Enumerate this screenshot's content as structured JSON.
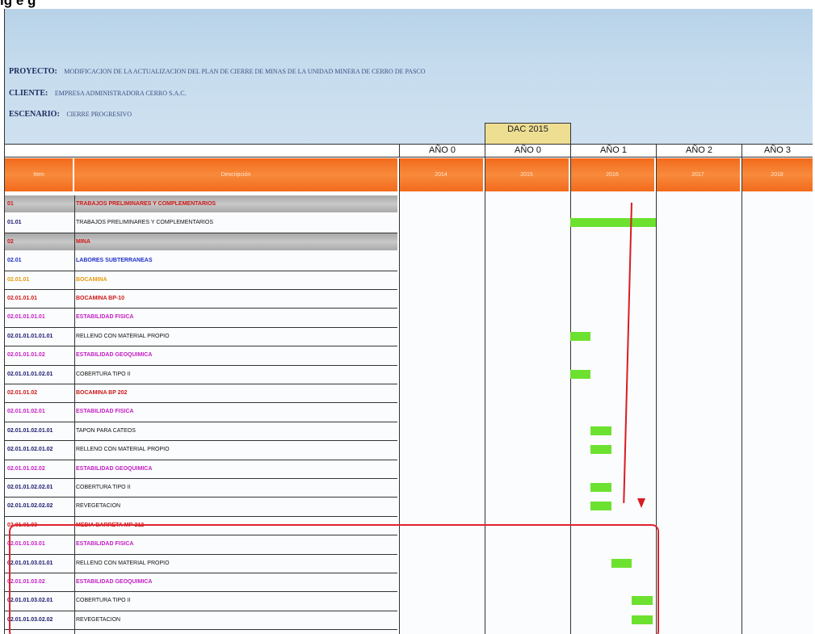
{
  "caption": "ig  e        g",
  "header": {
    "proyecto_label": "PROYECTO:",
    "proyecto_value": "MODIFICACION DE LA ACTUALIZACION DEL PLAN DE CIERRE DE MINAS DE LA UNIDAD MINERA DE CERRO DE PASCO",
    "cliente_label": "CLIENTE:",
    "cliente_value": "EMPRESA ADMINISTRADORA CERRO S.A.C.",
    "escenario_label": "ESCENARIO:",
    "escenario_value": "CIERRE PROGRESIVO",
    "dac_label": "DAC 2015"
  },
  "columns": {
    "item": "Item",
    "descripcion": "Descripción",
    "years": [
      {
        "label": "AÑO 0",
        "year": "2014"
      },
      {
        "label": "AÑO 0",
        "year": "2015"
      },
      {
        "label": "AÑO 1",
        "year": "2016"
      },
      {
        "label": "AÑO 2",
        "year": "2017"
      },
      {
        "label": "AÑO 3",
        "year": "2018"
      }
    ]
  },
  "rows": [
    {
      "code": "01",
      "desc": "TRABAJOS PRELIMINARES Y COMPLEMENTARIOS",
      "style": "grey",
      "color": "#d01818"
    },
    {
      "code": "01.01",
      "desc": "TRABAJOS PRELIMINARES Y COMPLEMENTARIOS",
      "style": "plain",
      "color": "#111111"
    },
    {
      "code": "02",
      "desc": "MINA",
      "style": "grey",
      "color": "#d01818"
    },
    {
      "code": "02.01",
      "desc": "LABORES SUBTERRANEAS",
      "style": "white",
      "color": "#1f2fc9"
    },
    {
      "code": "02.01.01",
      "desc": "BOCAMINA",
      "style": "white",
      "color": "#e69a0a"
    },
    {
      "code": "02.01.01.01",
      "desc": "BOCAMINA BP-10",
      "style": "white",
      "color": "#d01818"
    },
    {
      "code": "02.01.01.01.01",
      "desc": "ESTABILIDAD FISICA",
      "style": "white",
      "color": "#c41ec4"
    },
    {
      "code": "02.01.01.01.01.01",
      "desc": "RELLENO CON MATERIAL PROPIO",
      "style": "plain",
      "color": "#111111"
    },
    {
      "code": "02.01.01.01.02",
      "desc": "ESTABILIDAD GEOQUIMICA",
      "style": "white",
      "color": "#c41ec4"
    },
    {
      "code": "02.01.01.01.02.01",
      "desc": "COBERTURA TIPO II",
      "style": "plain",
      "color": "#111111"
    },
    {
      "code": "02.01.01.02",
      "desc": "BOCAMINA BP 202",
      "style": "white",
      "color": "#d01818"
    },
    {
      "code": "02.01.01.02.01",
      "desc": "ESTABILIDAD FISICA",
      "style": "white",
      "color": "#c41ec4"
    },
    {
      "code": "02.01.01.02.01.01",
      "desc": "TAPON PARA CATEOS",
      "style": "plain",
      "color": "#111111"
    },
    {
      "code": "02.01.01.02.01.02",
      "desc": "RELLENO CON MATERIAL PROPIO",
      "style": "plain",
      "color": "#111111"
    },
    {
      "code": "02.01.01.02.02",
      "desc": "ESTABILIDAD GEOQUIMICA",
      "style": "white",
      "color": "#c41ec4"
    },
    {
      "code": "02.01.01.02.02.01",
      "desc": "COBERTURA TIPO II",
      "style": "plain",
      "color": "#111111"
    },
    {
      "code": "02.01.01.02.02.02",
      "desc": "REVEGETACION",
      "style": "plain",
      "color": "#111111"
    },
    {
      "code": "02.01.01.03",
      "desc": "MEDIA BARRETA MP-212",
      "style": "white",
      "color": "#d01818"
    },
    {
      "code": "02.01.01.03.01",
      "desc": "ESTABILIDAD FISICA",
      "style": "white",
      "color": "#c41ec4"
    },
    {
      "code": "02.01.01.03.01.01",
      "desc": "RELLENO CON MATERIAL PROPIO",
      "style": "plain",
      "color": "#111111"
    },
    {
      "code": "02.01.01.03.02",
      "desc": "ESTABILIDAD GEOQUIMICA",
      "style": "white",
      "color": "#c41ec4"
    },
    {
      "code": "02.01.01.03.02.01",
      "desc": "COBERTURA TIPO II",
      "style": "plain",
      "color": "#111111"
    },
    {
      "code": "02.01.01.03.02.02",
      "desc": "REVEGETACION",
      "style": "plain",
      "color": "#111111"
    }
  ],
  "schedule": [
    {
      "row": 1,
      "year": "2016",
      "start": 0.0,
      "end": 1.0
    },
    {
      "row": 7,
      "year": "2016",
      "start": 0.0,
      "end": 0.24
    },
    {
      "row": 9,
      "year": "2016",
      "start": 0.0,
      "end": 0.24
    },
    {
      "row": 12,
      "year": "2016",
      "start": 0.24,
      "end": 0.48
    },
    {
      "row": 13,
      "year": "2016",
      "start": 0.24,
      "end": 0.48
    },
    {
      "row": 15,
      "year": "2016",
      "start": 0.24,
      "end": 0.48
    },
    {
      "row": 16,
      "year": "2016",
      "start": 0.24,
      "end": 0.48
    },
    {
      "row": 19,
      "year": "2016",
      "start": 0.48,
      "end": 0.72
    },
    {
      "row": 21,
      "year": "2016",
      "start": 0.72,
      "end": 0.96
    },
    {
      "row": 22,
      "year": "2016",
      "start": 0.72,
      "end": 0.96
    }
  ],
  "colors": {
    "accent_orange": "#f36a1c",
    "bar_green": "#6de12f",
    "highlight_red": "#e0232f"
  }
}
